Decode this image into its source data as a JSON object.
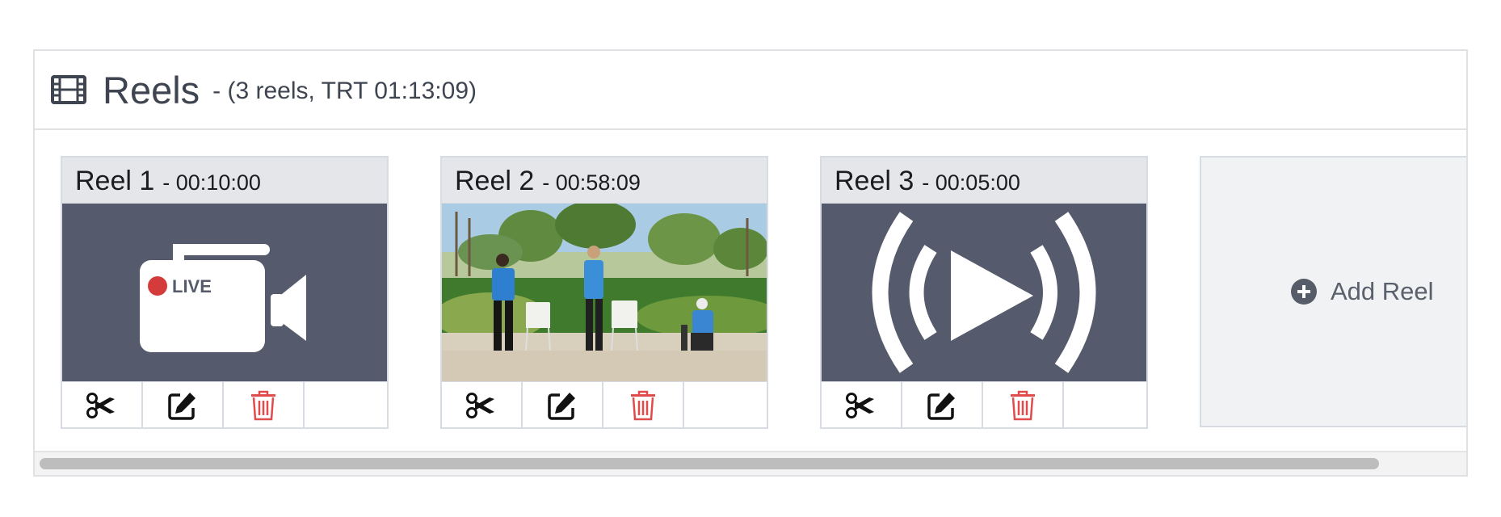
{
  "header": {
    "title": "Reels",
    "summary": "- (3 reels, TRT 01:13:09)",
    "icon": "film-icon"
  },
  "reels": [
    {
      "name": "Reel 1",
      "duration": "- 00:10:00",
      "thumbnail": "live-camera-icon",
      "live_label": "LIVE"
    },
    {
      "name": "Reel 2",
      "duration": "- 00:58:09",
      "thumbnail": "video-frame-outdoor-three-people"
    },
    {
      "name": "Reel 3",
      "duration": "- 00:05:00",
      "thumbnail": "broadcast-play-icon"
    }
  ],
  "actions": [
    "scissors-icon",
    "edit-icon",
    "trash-icon"
  ],
  "add_reel": {
    "label": "Add Reel",
    "icon": "plus-circle-icon"
  },
  "colors": {
    "thumb_bg": "#555b6c",
    "header_bg": "#e4e6ea",
    "delete_red": "#e04b4b",
    "text_dark": "#3e4450"
  }
}
